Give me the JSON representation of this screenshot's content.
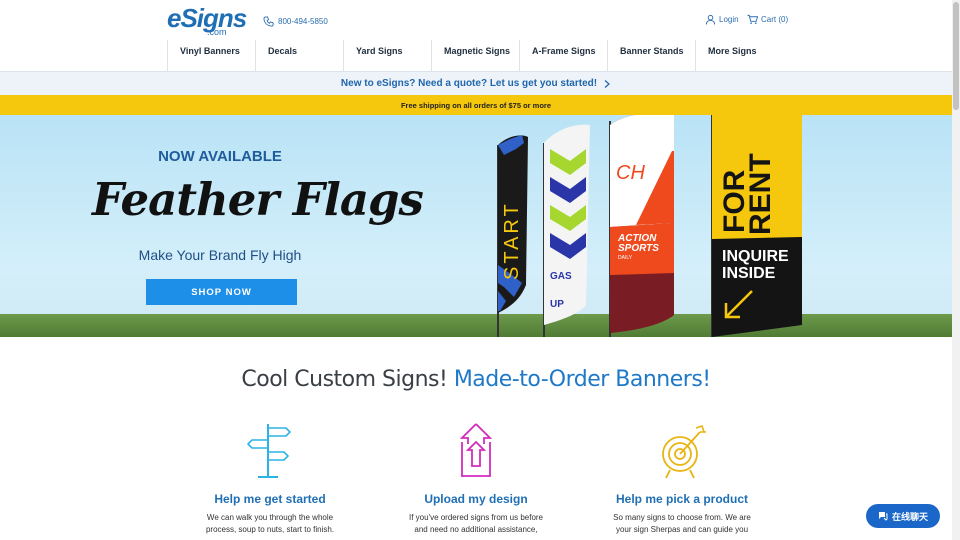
{
  "header": {
    "logo_word": "eSigns",
    "logo_suffix": ".com",
    "phone": "800-494-5850",
    "login_label": "Login",
    "cart_label": "Cart (0)"
  },
  "nav": {
    "items": [
      {
        "label": "Vinyl Banners"
      },
      {
        "label": "Decals"
      },
      {
        "label": "Yard Signs"
      },
      {
        "label": "Magnetic Signs"
      },
      {
        "label": "A-Frame Signs"
      },
      {
        "label": "Banner Stands"
      },
      {
        "label": "More Signs"
      }
    ]
  },
  "quote_bar": {
    "text": "New to eSigns? Need a quote? Let us get you started!"
  },
  "shipping_bar": {
    "text": "Free shipping on all orders of $75 or more"
  },
  "hero": {
    "kicker": "NOW AVAILABLE",
    "title": "Feather Flags",
    "subtitle": "Make Your Brand Fly High",
    "cta": "SHOP NOW",
    "flags": {
      "flag1": "START",
      "flag2_line1": "GAS",
      "flag2_line2": "UP",
      "flag3_top": "CH",
      "flag3_mid1": "ACTION",
      "flag3_mid2": "SPORTS",
      "flag3_mid3": "DAILY",
      "flag4_line1": "FOR",
      "flag4_line2": "RENT",
      "flag4_line3": "INQUIRE",
      "flag4_line4": "INSIDE"
    }
  },
  "section": {
    "title_plain": "Cool Custom Signs! ",
    "title_highlight": "Made-to-Order Banners!"
  },
  "features": [
    {
      "title": "Help me get started",
      "desc": "We can walk you through the whole process, soup to nuts, start to finish."
    },
    {
      "title": "Upload my design",
      "desc": "If you've ordered signs from us before and need no additional assistance,"
    },
    {
      "title": "Help me pick a product",
      "desc": "So many signs to choose from. We are your sign Sherpas and can guide you"
    }
  ],
  "chat": {
    "label": "在线聊天"
  },
  "colors": {
    "brand_blue": "#1f6fb5",
    "cta_blue": "#1e8fe8",
    "shipping_yellow": "#f5c80d"
  }
}
